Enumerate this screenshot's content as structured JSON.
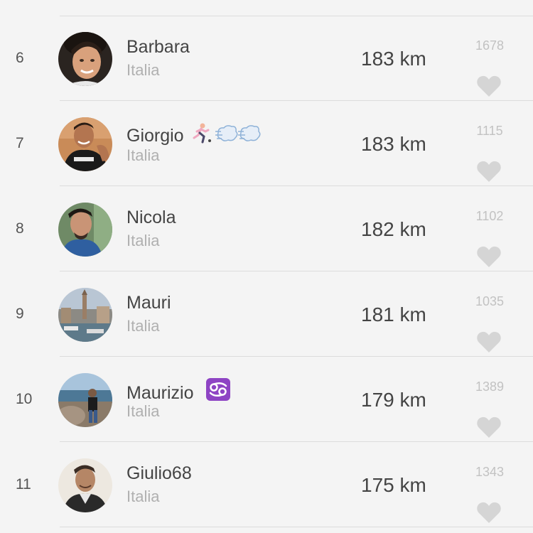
{
  "leaderboard": {
    "rows": [
      {
        "rank": "6",
        "name": "Barbara",
        "country": "Italia",
        "distance": "183 km",
        "likes": "1678",
        "avatar_icon": "avatar-photo-woman"
      },
      {
        "rank": "7",
        "name": "Giorgio",
        "country": "Italia",
        "distance": "183 km",
        "likes": "1115",
        "avatar_icon": "avatar-photo-runner",
        "emoji": [
          "runner-emoji",
          "dash-emoji",
          "dash-emoji"
        ]
      },
      {
        "rank": "8",
        "name": "Nicola",
        "country": "Italia",
        "distance": "182 km",
        "likes": "1102",
        "avatar_icon": "avatar-photo-man"
      },
      {
        "rank": "9",
        "name": "Mauri",
        "country": "Italia",
        "distance": "181 km",
        "likes": "1035",
        "avatar_icon": "avatar-photo-city"
      },
      {
        "rank": "10",
        "name": "Maurizio",
        "country": "Italia",
        "distance": "179 km",
        "likes": "1389",
        "avatar_icon": "avatar-photo-seaside",
        "emoji": [
          "cancer-zodiac-emoji"
        ]
      },
      {
        "rank": "11",
        "name": "Giulio68",
        "country": "Italia",
        "distance": "175 km",
        "likes": "1343",
        "avatar_icon": "avatar-photo-man-sky"
      }
    ]
  },
  "colors": {
    "background": "#f4f4f4",
    "divider": "#dcdcdc",
    "text_primary": "#444444",
    "text_secondary": "#b0b0b0",
    "heart": "#d5d5d5",
    "zodiac_badge": "#8e44c4"
  }
}
